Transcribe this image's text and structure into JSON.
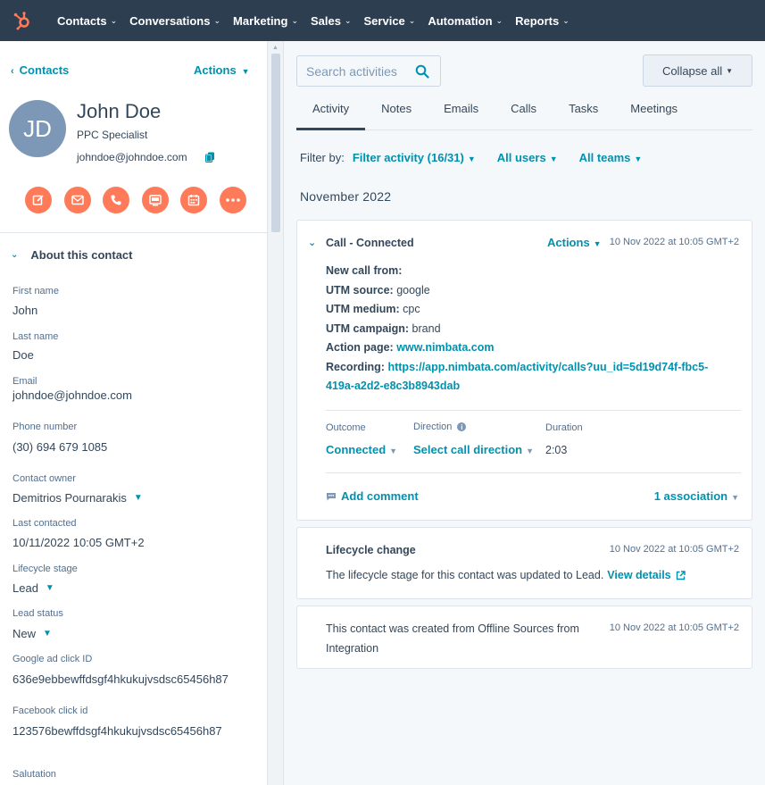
{
  "nav": {
    "items": [
      {
        "label": "Contacts"
      },
      {
        "label": "Conversations"
      },
      {
        "label": "Marketing"
      },
      {
        "label": "Sales"
      },
      {
        "label": "Service"
      },
      {
        "label": "Automation"
      },
      {
        "label": "Reports"
      }
    ],
    "brand_color": "#ff7a59"
  },
  "contact": {
    "back_label": "Contacts",
    "actions_label": "Actions",
    "initials": "JD",
    "name": "John Doe",
    "title": "PPC Specialist",
    "email": "johndoe@johndoe.com",
    "action_icons": [
      "note-icon",
      "email-icon",
      "call-icon",
      "log-icon",
      "task-icon",
      "more-icon"
    ]
  },
  "about": {
    "heading": "About this contact",
    "fields": [
      {
        "label": "First name",
        "value": "John"
      },
      {
        "label": "Last name",
        "value": "Doe"
      },
      {
        "label": "Email",
        "value": "johndoe@johndoe.com"
      },
      {
        "label": "Phone number",
        "value": "(30) 694 679 1085"
      },
      {
        "label": "Contact owner",
        "value": "Demitrios Pournarakis"
      },
      {
        "label": "Last contacted",
        "value": "10/11/2022 10:05 GMT+2"
      },
      {
        "label": "Lifecycle stage",
        "value": "Lead"
      },
      {
        "label": "Lead status",
        "value": "New"
      },
      {
        "label": "Google ad click ID",
        "value": "636e9ebbewffdsgf4hkukujvsdsc65456h87"
      },
      {
        "label": "Facebook click id",
        "value": "123576bewffdsgf4hkukujvsdsc65456h87"
      },
      {
        "label": "Salutation",
        "value": ""
      }
    ]
  },
  "main": {
    "search_placeholder": "Search activities",
    "collapse_label": "Collapse all",
    "tabs": [
      {
        "label": "Activity"
      },
      {
        "label": "Notes"
      },
      {
        "label": "Emails"
      },
      {
        "label": "Calls"
      },
      {
        "label": "Tasks"
      },
      {
        "label": "Meetings"
      }
    ],
    "filter": {
      "label": "Filter by:",
      "activity": "Filter activity (16/31)",
      "users": "All users",
      "teams": "All teams"
    },
    "month": "November 2022"
  },
  "call_card": {
    "title": "Call - Connected",
    "actions_label": "Actions",
    "time": "10 Nov 2022 at 10:05 GMT+2",
    "lines": {
      "new_call": "New call from:",
      "utm_source_k": "UTM source:",
      "utm_source_v": "google",
      "utm_medium_k": "UTM medium:",
      "utm_medium_v": "cpc",
      "utm_campaign_k": "UTM campaign:",
      "utm_campaign_v": "brand",
      "action_page_k": "Action page:",
      "action_page_v": "www.nimbata.com",
      "recording_k": "Recording:",
      "recording_v1": "https://app.nimbata.com/activity/calls?uu_id=5d19d74f-fbc5-",
      "recording_v2": "419a-a2d2-e8c3b8943dab"
    },
    "outcome_label": "Outcome",
    "outcome_value": "Connected",
    "direction_label": "Direction",
    "direction_value": "Select call direction",
    "duration_label": "Duration",
    "duration_value": "2:03",
    "comment_label": "Add comment",
    "association_label": "1 association"
  },
  "lifecycle_card": {
    "title": "Lifecycle change",
    "time": "10 Nov 2022 at 10:05 GMT+2",
    "text": "The lifecycle stage for this contact was updated to Lead.",
    "link": "View details"
  },
  "created_card": {
    "line1": "This contact was created from Offline Sources from",
    "line2": "Integration",
    "time": "10 Nov 2022 at 10:05 GMT+2"
  }
}
